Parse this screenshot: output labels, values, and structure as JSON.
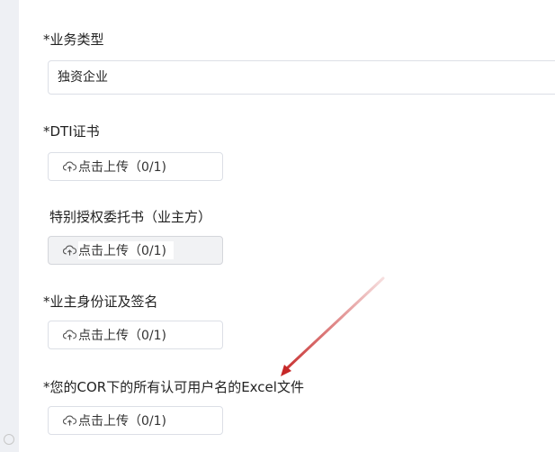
{
  "fields": {
    "business_type": {
      "label": "*业务类型",
      "value": "独资企业"
    },
    "dti_certificate": {
      "label": "*DTI证书",
      "upload_text": "点击上传（0/1)"
    },
    "special_authorization": {
      "label": "特别授权委托书（业主方）",
      "upload_text": "点击上传（0/1)"
    },
    "owner_id_signature": {
      "label": "*业主身份证及签名",
      "upload_text": "点击上传（0/1)"
    },
    "cor_excel": {
      "label": "*您的COR下的所有认可用户名的Excel文件",
      "upload_text": "点击上传（0/1)"
    }
  },
  "icons": {
    "upload": "cloud-upload-icon",
    "arrow": "red-arrow-annotation"
  },
  "colors": {
    "arrow": "#c62828",
    "border": "#dcdfe6",
    "gutter": "#eef0f4"
  }
}
